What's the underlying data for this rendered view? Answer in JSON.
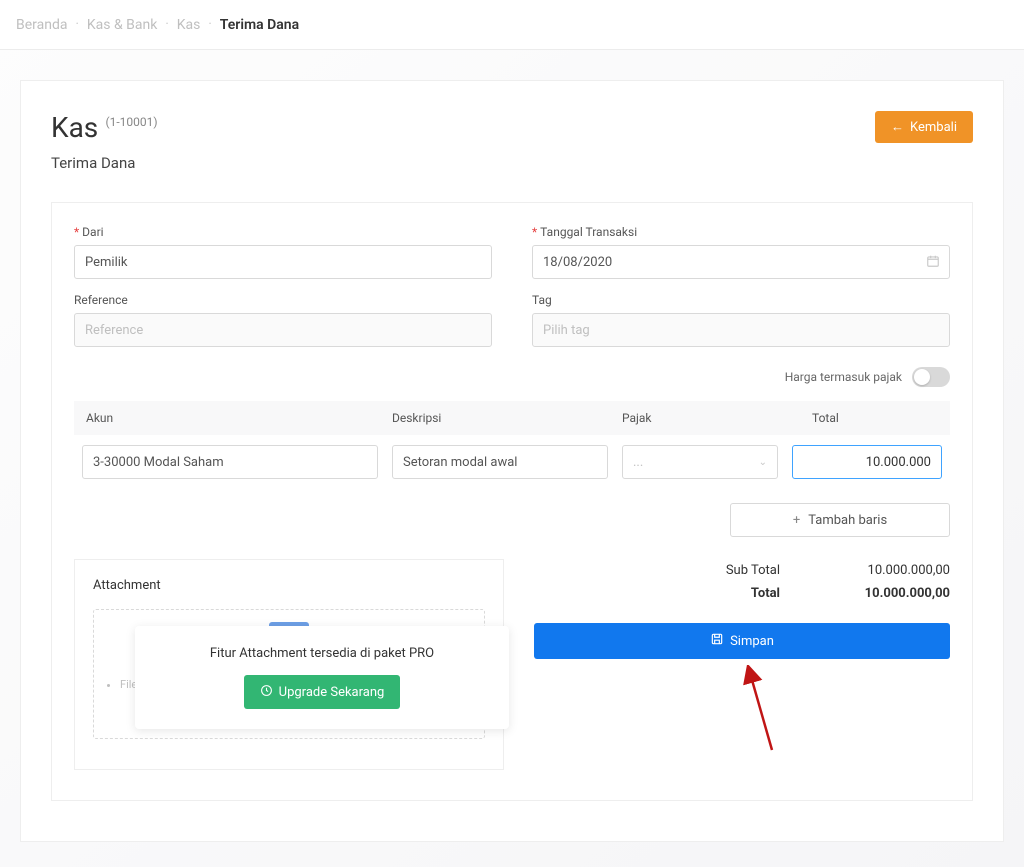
{
  "breadcrumb": {
    "items": [
      "Beranda",
      "Kas & Bank",
      "Kas",
      "Terima Dana"
    ]
  },
  "header": {
    "title": "Kas",
    "code": "(1-10001)",
    "subtitle": "Terima Dana",
    "back_label": "Kembali"
  },
  "form": {
    "from_label": "Dari",
    "from_value": "Pemilik",
    "ref_label": "Reference",
    "ref_placeholder": "Reference",
    "date_label": "Tanggal Transaksi",
    "date_value": "18/08/2020",
    "tag_label": "Tag",
    "tag_placeholder": "Pilih tag",
    "tax_label": "Harga termasuk pajak"
  },
  "table": {
    "headers": {
      "akun": "Akun",
      "desk": "Deskripsi",
      "pajak": "Pajak",
      "total": "Total"
    },
    "row": {
      "akun": "3-30000 Modal Saham",
      "desk": "Setoran modal awal",
      "pajak": "...",
      "total": "10.000.000"
    },
    "add_label": "Tambah baris"
  },
  "attachment": {
    "title": "Attachment",
    "note": "File siz",
    "popup_text": "Fitur Attachment tersedia di paket PRO",
    "upgrade_label": "Upgrade Sekarang"
  },
  "totals": {
    "sub_label": "Sub Total",
    "sub_value": "10.000.000,00",
    "total_label": "Total",
    "total_value": "10.000.000,00",
    "save_label": "Simpan"
  }
}
